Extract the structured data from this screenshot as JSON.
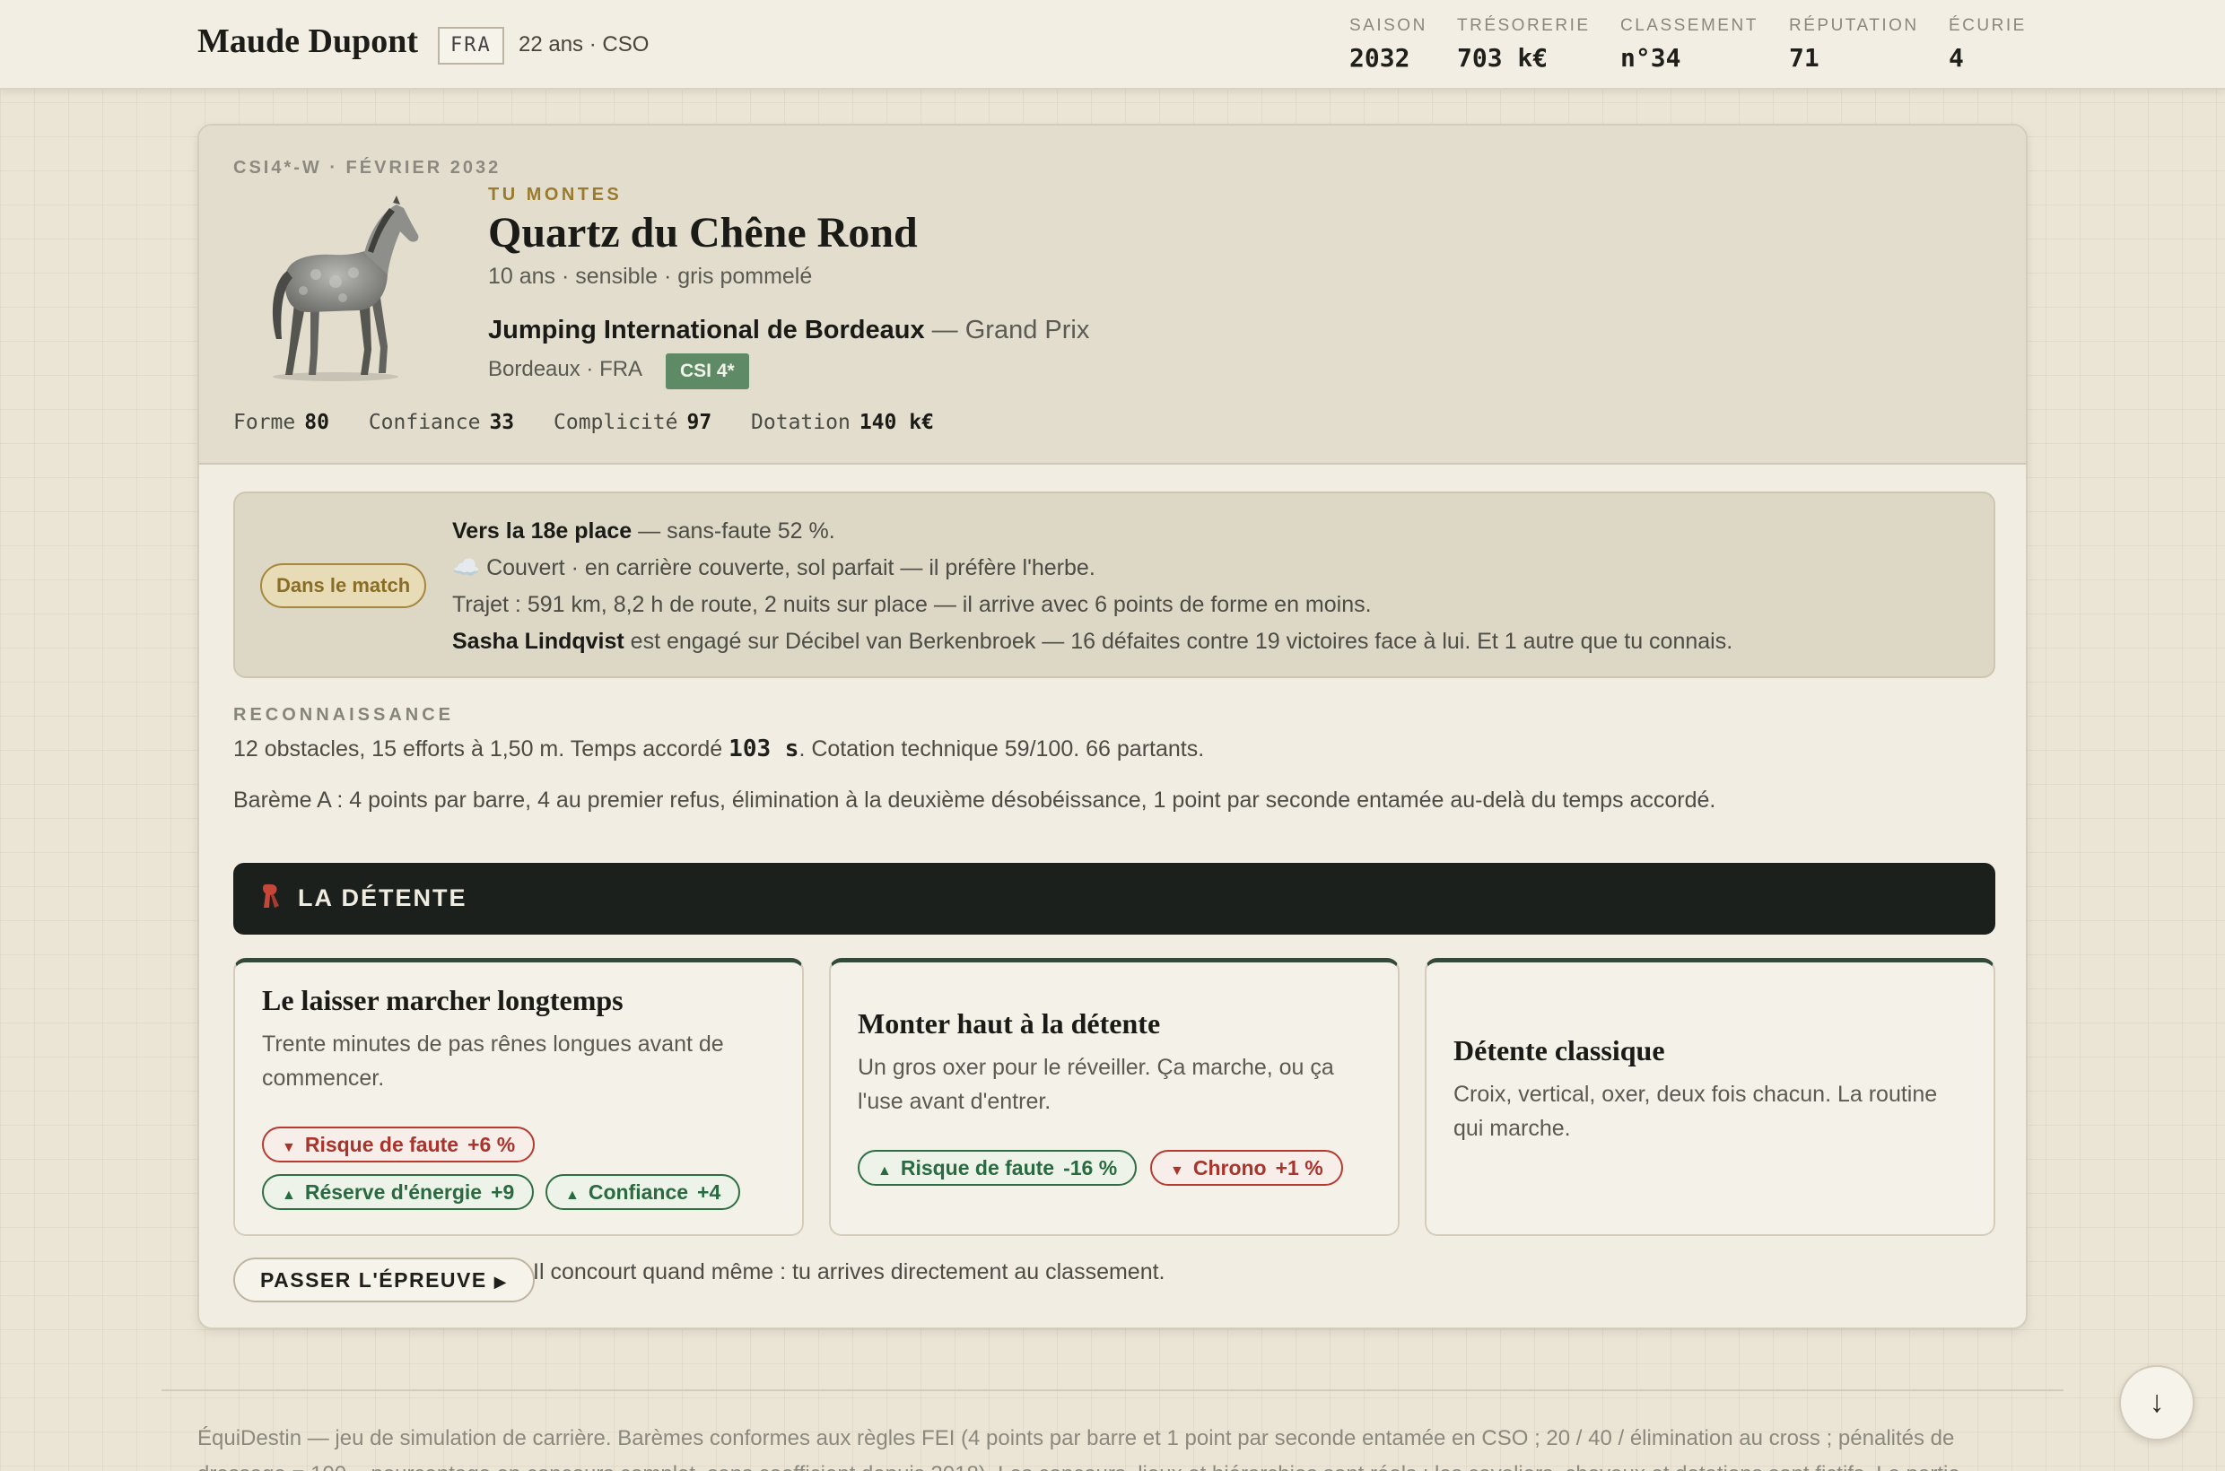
{
  "header": {
    "player_name": "Maude Dupont",
    "nation": "FRA",
    "meta": "22 ans · CSO",
    "stats": [
      {
        "label": "SAISON",
        "value": "2032"
      },
      {
        "label": "TRÉSORERIE",
        "value": "703 k€"
      },
      {
        "label": "CLASSEMENT",
        "value": "n°34"
      },
      {
        "label": "RÉPUTATION",
        "value": "71"
      },
      {
        "label": "ÉCURIE",
        "value": "4"
      }
    ]
  },
  "event": {
    "kicker": "CSI4*-W · FÉVRIER 2032",
    "ride_label": "TU MONTES",
    "horse_name": "Quartz du Chêne Rond",
    "horse_desc": "10 ans · sensible · gris pommelé",
    "event_name": "Jumping International de Bordeaux",
    "event_suffix": " — Grand Prix",
    "location": "Bordeaux · FRA",
    "level": "CSI 4*",
    "horse_stats": [
      {
        "label": "Forme",
        "value": "80"
      },
      {
        "label": "Confiance",
        "value": "33"
      },
      {
        "label": "Complicité",
        "value": "97"
      },
      {
        "label": "Dotation",
        "value": "140 k€"
      }
    ]
  },
  "outlook": {
    "badge": "Dans le match",
    "line1_bold": "Vers la 18e place",
    "line1_rest": " — sans-faute 52 %.",
    "line2_icon": "☁️",
    "line2": " Couvert · en carrière couverte, sol parfait — il préfère l'herbe.",
    "line3": "Trajet : 591 km, 8,2 h de route, 2 nuits sur place — il arrive avec 6 points de forme en moins.",
    "line4_bold": "Sasha Lindqvist",
    "line4_rest": " est engagé sur Décibel van Berkenbroek — 16 défaites contre 19 victoires face à lui. Et 1 autre que tu connais."
  },
  "recon": {
    "title": "RECONNAISSANCE",
    "text_a": "12 obstacles, 15 efforts à 1,50 m. Temps accordé ",
    "time": "103 s",
    "text_b": ". Cotation technique 59/100. 66 partants.",
    "bareme": "Barème A : 4 points par barre, 4 au premier refus, élimination à la deuxième désobéissance, 1 point par seconde entamée au-delà du temps accordé."
  },
  "detente": {
    "icon": "scarf-icon",
    "title": "LA DÉTENTE",
    "options": [
      {
        "title": "Le laisser marcher longtemps",
        "desc": "Trente minutes de pas rênes longues avant de commencer.",
        "effects": [
          {
            "label": "Risque de faute",
            "amount": "+6 %",
            "kind": "neg",
            "arrow": "▼"
          },
          {
            "label": "Réserve d'énergie",
            "amount": "+9",
            "kind": "pos",
            "arrow": "▲"
          },
          {
            "label": "Confiance",
            "amount": "+4",
            "kind": "pos",
            "arrow": "▲"
          }
        ]
      },
      {
        "title": "Monter haut à la détente",
        "desc": "Un gros oxer pour le réveiller. Ça marche, ou ça l'use avant d'entrer.",
        "effects": [
          {
            "label": "Risque de faute",
            "amount": "-16 %",
            "kind": "pos",
            "arrow": "▲"
          },
          {
            "label": "Chrono",
            "amount": "+1 %",
            "kind": "neg",
            "arrow": "▼"
          }
        ]
      },
      {
        "title": "Détente classique",
        "desc": "Croix, vertical, oxer, deux fois chacun. La routine qui marche.",
        "effects": []
      }
    ]
  },
  "skip": {
    "label": "PASSER L'ÉPREUVE",
    "arrow": "▶",
    "note": "Il concourt quand même : tu arrives directement au classement."
  },
  "footer": {
    "text": "ÉquiDestin — jeu de simulation de carrière. Barèmes conformes aux règles FEI (4 points par barre et 1 point par seconde entamée en CSO ; 20 / 40 / élimination au cross ; pénalités de dressage = 100 − pourcentage en concours complet, sans coefficient depuis 2018). Les concours, lieux et hiérarchies sont réels ; les cavaliers, chevaux et dotations sont fictifs. La partie est enregistrée dans ce"
  },
  "scroll_button": {
    "icon": "arrow-down-icon",
    "glyph": "↓"
  },
  "colors": {
    "accent_dark": "#1c201d",
    "positive": "#2a6a40",
    "negative": "#a8342b",
    "level_badge": "#5e8b66",
    "gold": "#9a7a2c"
  }
}
